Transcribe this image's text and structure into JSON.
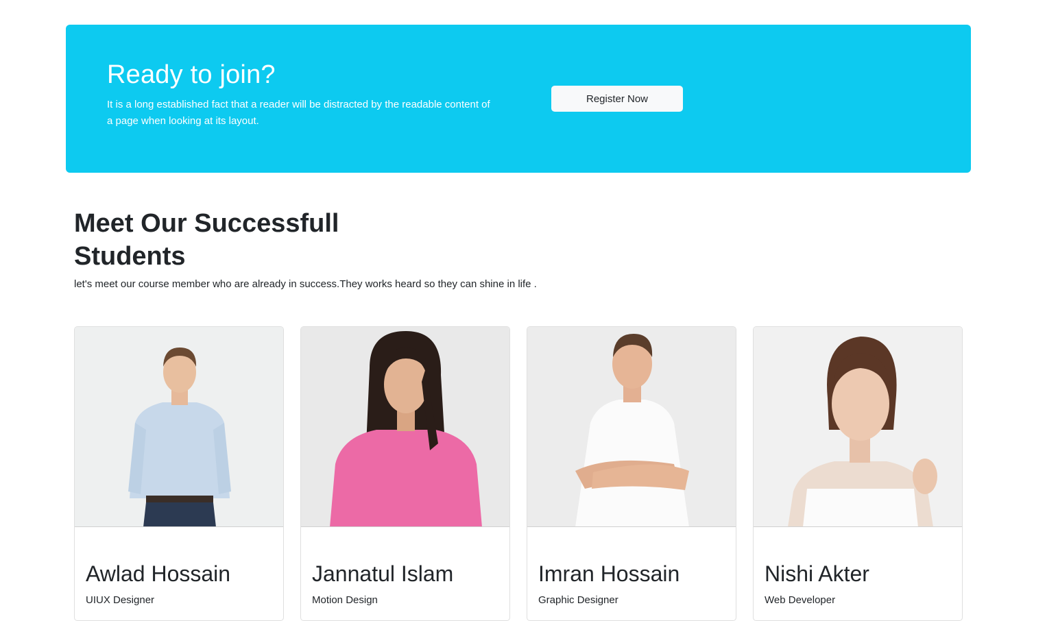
{
  "cta": {
    "title": "Ready to join?",
    "text": "It is a long established fact that a reader will be distracted by the readable content of a page when looking at its layout.",
    "button_label": "Register Now",
    "background_color": "#0dcaf0"
  },
  "section": {
    "title": "Meet Our Successfull Students",
    "subtitle": "let's meet our course member who are already in success.They works heard so they can shine in life ."
  },
  "students": [
    {
      "name": "Awlad Hossain",
      "role": "UIUX Designer",
      "photo": "person-photo-man-light-blue-shirt"
    },
    {
      "name": "Jannatul Islam",
      "role": "Motion Design",
      "photo": "person-photo-woman-pink-sweater"
    },
    {
      "name": "Imran Hossain",
      "role": "Graphic Designer",
      "photo": "person-photo-man-white-tshirt"
    },
    {
      "name": "Nishi Akter",
      "role": "Web Developer",
      "photo": "person-photo-woman-white-top"
    }
  ]
}
